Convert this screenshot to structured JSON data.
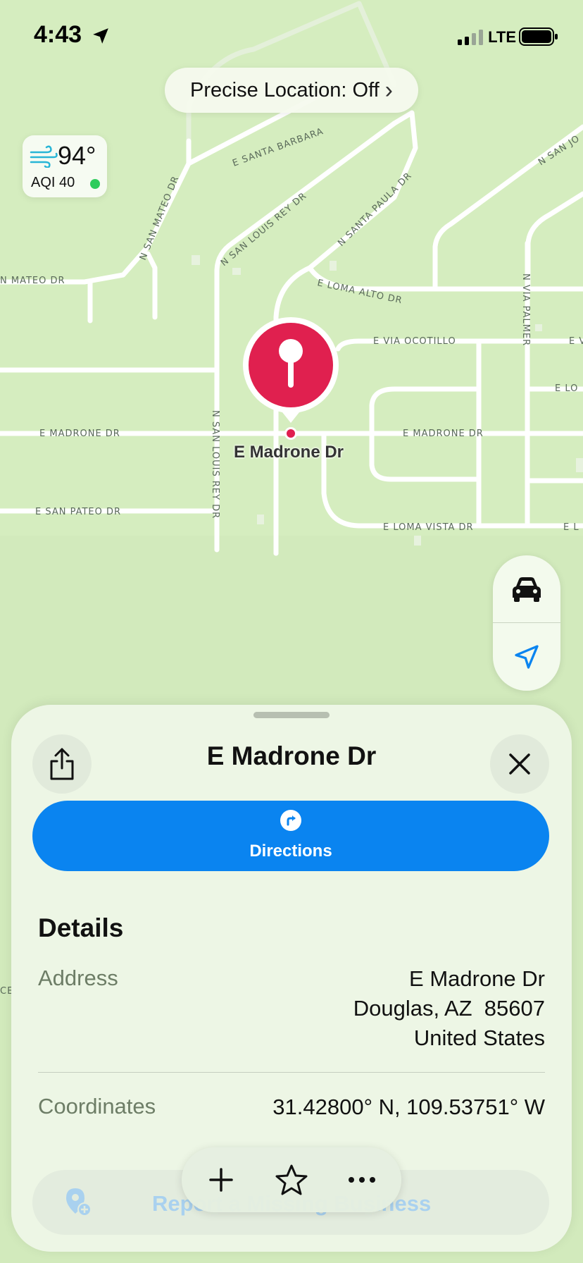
{
  "status_bar": {
    "time": "4:43",
    "network": "LTE",
    "icons": [
      "location-arrow-icon",
      "signal-icon",
      "battery-icon"
    ]
  },
  "precise_location": {
    "label": "Precise Location: Off",
    "chevron": "›"
  },
  "weather": {
    "temperature": "94°",
    "aqi": "AQI 40",
    "aqi_color": "#2ecc5c"
  },
  "map": {
    "pin_label": "E Madrone Dr",
    "pin_color": "#e0204f",
    "streets": {
      "santa_barbara": "E SANTA BARBARA",
      "san_mateo_dr": "N SAN MATEO DR",
      "mateo_dr": "N MATEO DR",
      "san_louis_rey_upper": "N SAN LOUIS REY DR",
      "santa_paula": "N SANTA PAULA DR",
      "san_jo": "N SAN JO",
      "loma_alto": "E LOMA ALTO DR",
      "via_palmer": "N VIA PALMER",
      "via_ocotillo": "E VIA OCOTILLO",
      "e_v": "E V",
      "e_lo": "E LO",
      "madrone_left": "E MADRONE DR",
      "madrone_right": "E MADRONE DR",
      "san_louis_rey_lower": "N SAN LOUIS REY DR",
      "san_pateo": "E SAN PATEO DR",
      "loma_vista": "E LOMA VISTA DR",
      "e_l": "E L",
      "ce": "CE"
    }
  },
  "sheet": {
    "title": "E Madrone Dr",
    "directions_label": "Directions",
    "details_heading": "Details",
    "address_label": "Address",
    "address_lines": [
      "E Madrone Dr",
      "Douglas, AZ  85607",
      "United States"
    ],
    "coordinates_label": "Coordinates",
    "coordinates_value": "31.42800° N, 109.53751° W",
    "report_label": "Report a Missing Business"
  },
  "accent_color": "#0a84f0"
}
